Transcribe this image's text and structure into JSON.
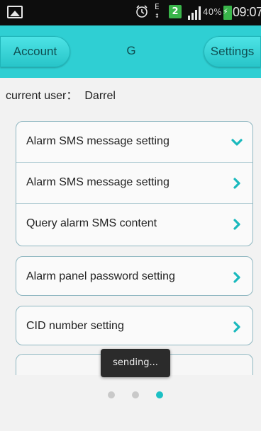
{
  "status_bar": {
    "sim_slot": "2",
    "e_label": "E",
    "e_sub": "↕",
    "battery_percent": "40%",
    "time": "09:07",
    "icons": [
      "gallery-icon",
      "alarm-clock-icon",
      "sim-icon",
      "signal-icon",
      "battery-charging-icon"
    ]
  },
  "header": {
    "account_label": "Account",
    "title": "G",
    "settings_label": "Settings",
    "accent_color": "#2fcfd3"
  },
  "current_user": {
    "label": "current user：",
    "value": "Darrel"
  },
  "groups": [
    {
      "items": [
        {
          "label": "Alarm SMS message setting",
          "icon": "chevron-down-icon"
        },
        {
          "label": "Alarm SMS message setting",
          "icon": "chevron-right-icon"
        },
        {
          "label": "Query alarm SMS content",
          "icon": "chevron-right-icon"
        }
      ]
    },
    {
      "items": [
        {
          "label": "Alarm panel password setting",
          "icon": "chevron-right-icon"
        }
      ]
    },
    {
      "items": [
        {
          "label": "CID number setting",
          "icon": "chevron-right-icon"
        }
      ]
    }
  ],
  "toast": {
    "text": "sending..."
  },
  "pager": {
    "pages": 3,
    "active_page": 3
  }
}
